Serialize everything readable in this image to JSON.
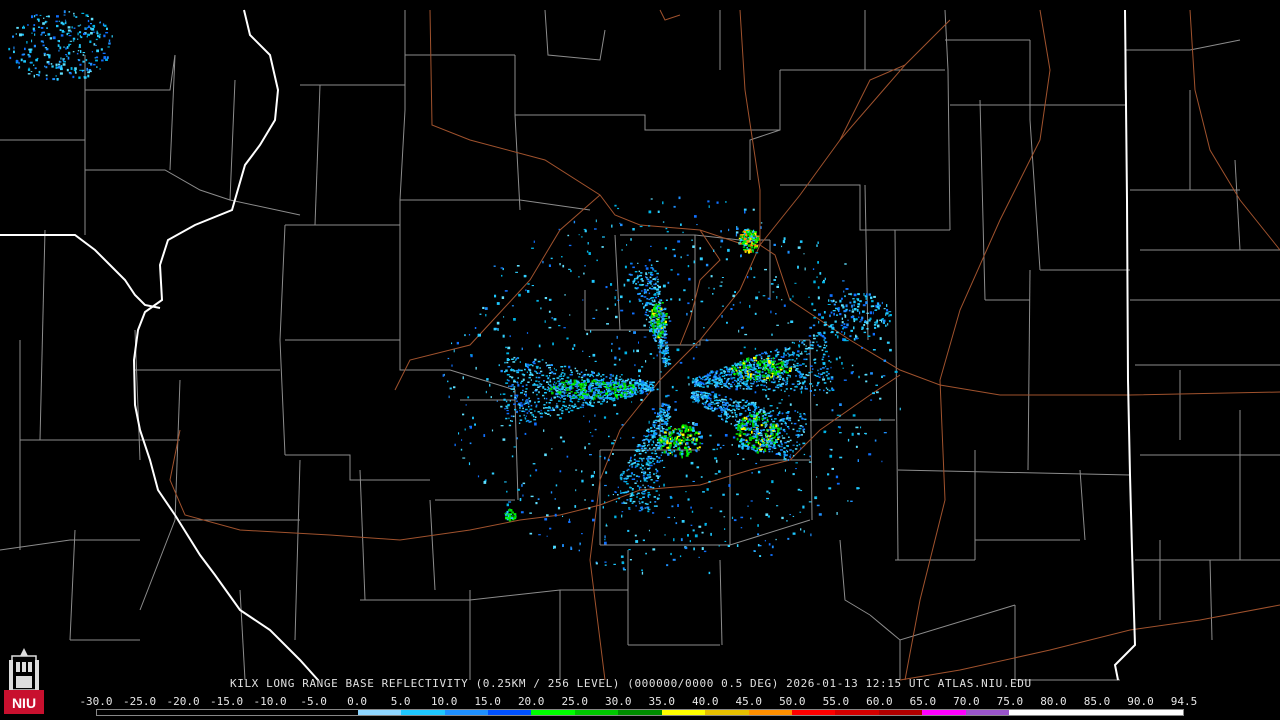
{
  "header": {
    "caption": "KILX LONG RANGE BASE REFLECTIVITY (0.25KM / 256 LEVEL) (000000/0000 0.5 DEG) 2026-01-13 12:15 UTC  ATLAS.NIU.EDU"
  },
  "logo": {
    "text": "NIU",
    "icon": "university-tower-logo"
  },
  "colorbar": {
    "ticks": [
      "-30.0",
      "-25.0",
      "-20.0",
      "-15.0",
      "-10.0",
      "-5.0",
      "0.0",
      "5.0",
      "10.0",
      "15.0",
      "20.0",
      "25.0",
      "30.0",
      "35.0",
      "40.0",
      "45.0",
      "50.0",
      "55.0",
      "60.0",
      "65.0",
      "70.0",
      "75.0",
      "80.0",
      "85.0",
      "90.0",
      "94.5"
    ],
    "colors": [
      "#000000",
      "#000000",
      "#000000",
      "#000000",
      "#000000",
      "#000000",
      "#8ed6ff",
      "#1ec8ff",
      "#1e90ff",
      "#0050ff",
      "#00ff00",
      "#00c800",
      "#008c00",
      "#ffff00",
      "#e6c000",
      "#ff9000",
      "#ff0000",
      "#d40000",
      "#b00000",
      "#ff00ff",
      "#9955c9",
      "#ffffff",
      "#ffffff",
      "#ffffff",
      "#ffffff"
    ]
  },
  "map_colors": {
    "background": "#000000",
    "state_border": "#ffffff",
    "county_border": "#9a9a9a",
    "highway": "#a0522d"
  }
}
